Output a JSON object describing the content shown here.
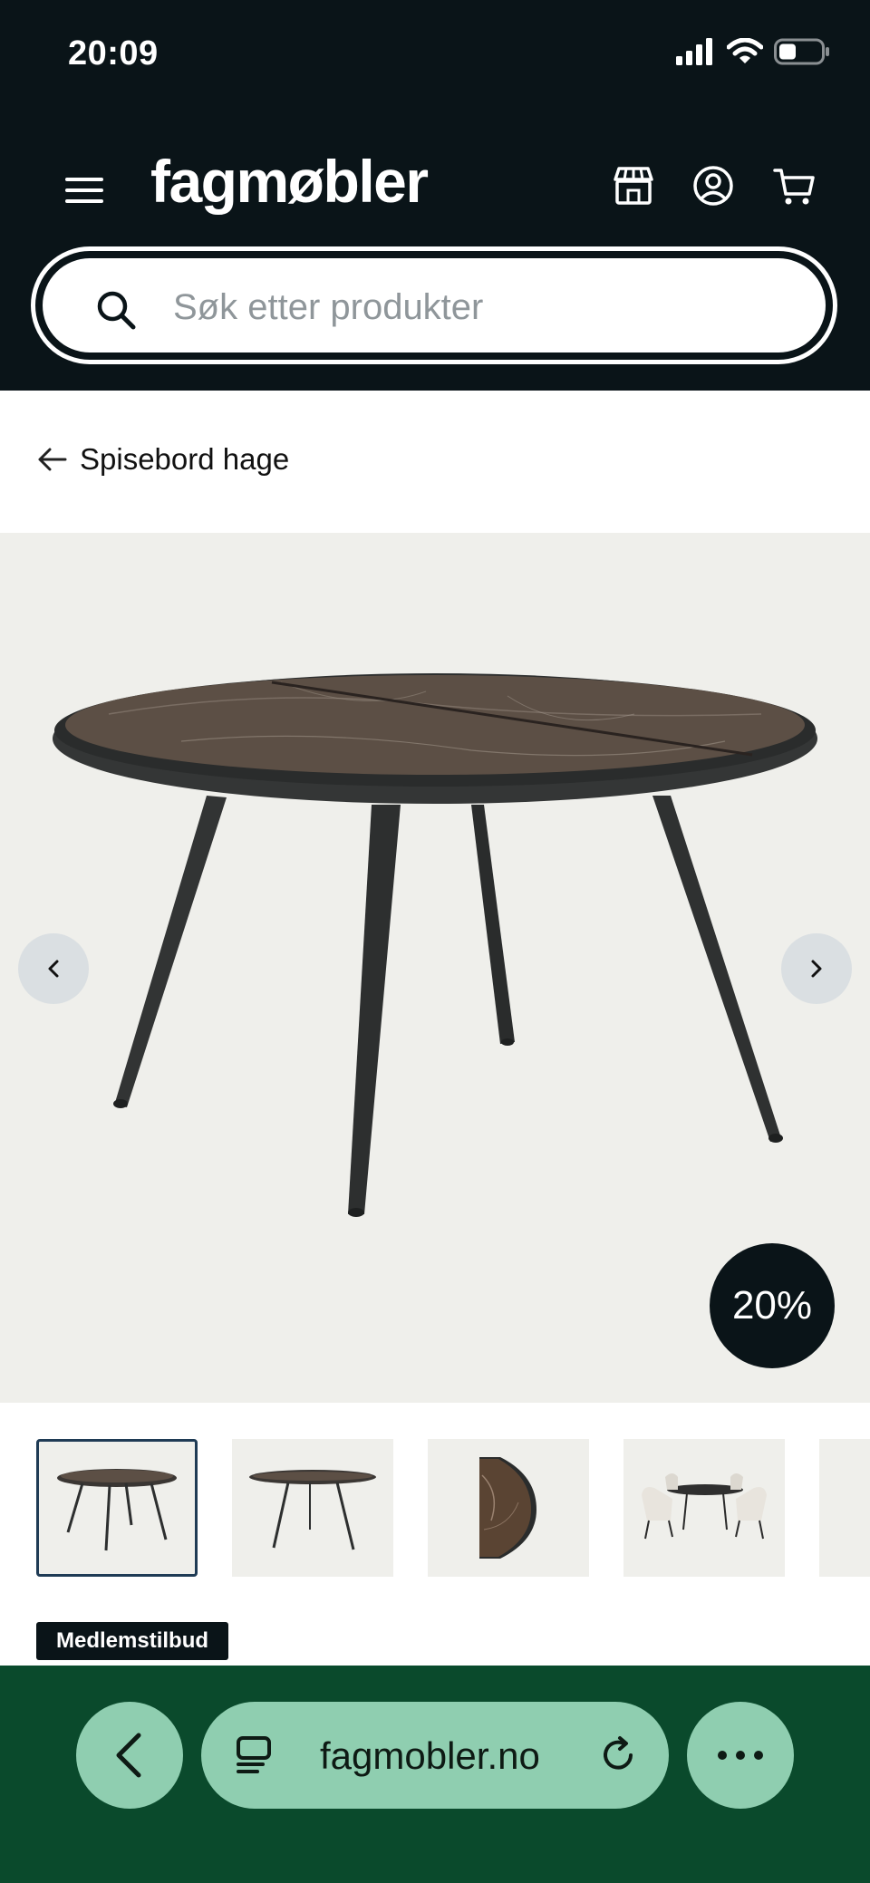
{
  "status_bar": {
    "time": "20:09"
  },
  "header": {
    "logo": "fagmøbler",
    "menu_icon": "hamburger-menu-icon",
    "icons": [
      "store-icon",
      "user-account-icon",
      "shopping-cart-icon"
    ]
  },
  "search": {
    "placeholder": "Søk etter produkter",
    "value": ""
  },
  "breadcrumb": {
    "label": "Spisebord hage"
  },
  "gallery": {
    "discount_label": "20%",
    "thumbnails": [
      {
        "name": "table-front-view",
        "active": true
      },
      {
        "name": "table-side-view",
        "active": false
      },
      {
        "name": "table-edge-detail",
        "active": false
      },
      {
        "name": "table-with-chairs",
        "active": false
      }
    ]
  },
  "product": {
    "badge": "Medlemstilbud"
  },
  "browser_bar": {
    "url": "fagmobler.no"
  },
  "colors": {
    "header_bg": "#0a1418",
    "gallery_bg": "#efefeb",
    "browser_bg": "#0a4a2c",
    "browser_buttons": "#8fceb0",
    "thumb_active_border": "#1f3b55"
  }
}
